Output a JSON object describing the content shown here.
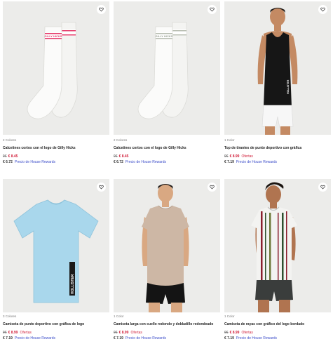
{
  "products": [
    {
      "colors": "2 Colores",
      "name": "Calcetines cortos con el logo de Gilly Hicks",
      "old_price": "9€",
      "price": "€ 8.45",
      "offer": "",
      "member_price": "€ 6.72",
      "member_label": "Precio de House Rewards",
      "image_icon": "socks-image",
      "logo_text": "GILLY HICKS",
      "logo_color": "#e53a6a"
    },
    {
      "colors": "2 Colores",
      "name": "Calcetines cortos con el logo de Gilly Hicks",
      "old_price": "9€",
      "price": "€ 8.45",
      "offer": "",
      "member_price": "€ 6.72",
      "member_label": "Precio de House Rewards",
      "image_icon": "socks-image",
      "logo_text": "GILLY HICKS",
      "logo_color": "#a9b0a3"
    },
    {
      "colors": "1 Color",
      "name": "Top de tirantes de punto deportivo con gráfica",
      "old_price": "9€",
      "price": "€ 8.99",
      "offer": "Ofertas",
      "member_price": "€ 7.19",
      "member_label": "Precio de House Rewards",
      "image_icon": "model-tank-top-image",
      "logo_text": "HOLLISTER"
    },
    {
      "colors": "3 Colores",
      "name": "Camiseta de punto deportivo con gráfica de logo",
      "old_price": "9€",
      "price": "€ 8.99",
      "offer": "Ofertas",
      "member_price": "€ 7.19",
      "member_label": "Precio de House Rewards",
      "image_icon": "tshirt-image",
      "logo_text": "HOLLISTER"
    },
    {
      "colors": "1 Color",
      "name": "Camiseta larga con cuello redondo y dobladillo redondeado",
      "old_price": "9€",
      "price": "€ 8.99",
      "offer": "Ofertas",
      "member_price": "€ 7.19",
      "member_label": "Precio de House Rewards",
      "image_icon": "model-long-tee-image"
    },
    {
      "colors": "1 Color",
      "name": "Camiseta de rayas con gráfico del logo bordado",
      "old_price": "9€",
      "price": "€ 8.99",
      "offer": "Ofertas",
      "member_price": "€ 7.19",
      "member_label": "Precio de House Rewards",
      "image_icon": "model-striped-tee-image"
    }
  ],
  "colors": {
    "sale_red": "#d11f3a",
    "rewards_blue": "#3b4cc9",
    "image_bg": "#ececea"
  },
  "icons": {
    "wishlist": "heart-icon"
  }
}
